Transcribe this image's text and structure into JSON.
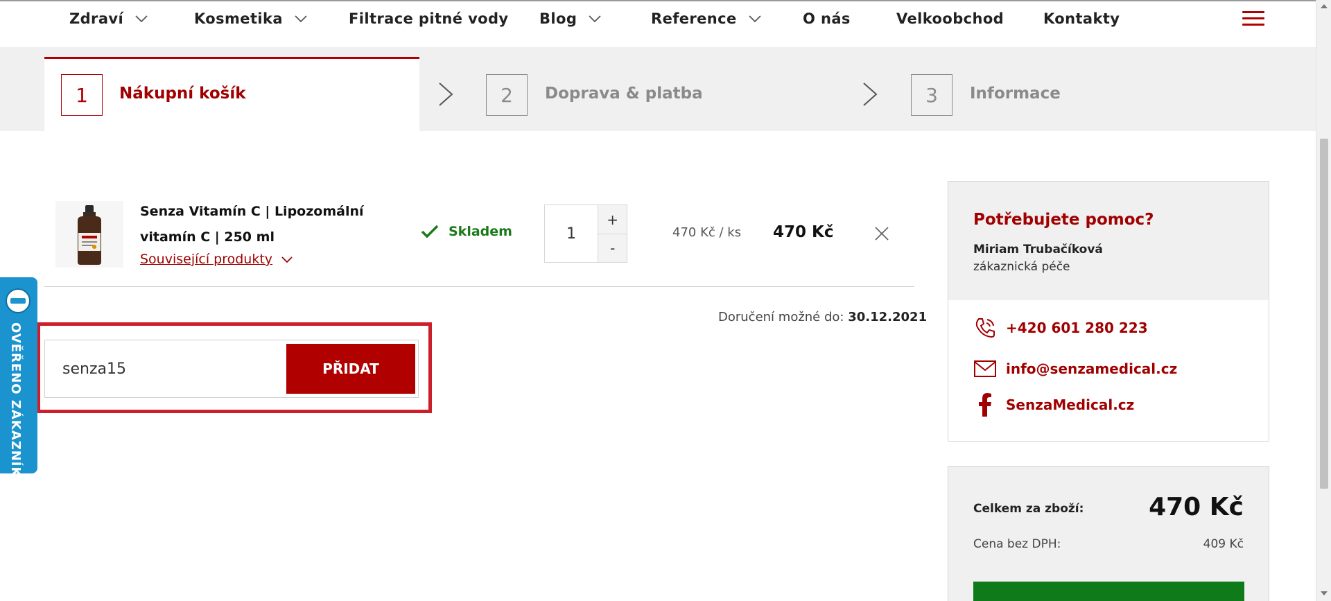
{
  "nav": {
    "items": [
      {
        "label": "Zdraví",
        "has_dropdown": true
      },
      {
        "label": "Kosmetika",
        "has_dropdown": true
      },
      {
        "label": "Filtrace pitné vody",
        "has_dropdown": false
      },
      {
        "label": "Blog",
        "has_dropdown": true
      },
      {
        "label": "Reference",
        "has_dropdown": true
      },
      {
        "label": "O nás",
        "has_dropdown": false
      },
      {
        "label": "Velkoobchod",
        "has_dropdown": false
      },
      {
        "label": "Kontakty",
        "has_dropdown": false
      }
    ],
    "menu_icon": "hamburger-icon"
  },
  "steps": [
    {
      "number": "1",
      "label": "Nákupní košík",
      "active": true
    },
    {
      "number": "2",
      "label": "Doprava & platba",
      "active": false
    },
    {
      "number": "3",
      "label": "Informace",
      "active": false
    }
  ],
  "cart": {
    "item": {
      "title": "Senza Vitamín C | Lipozomální vitamín C | 250 ml",
      "related_label": "Související produkty",
      "stock": "Skladem",
      "quantity": "1",
      "plus": "+",
      "minus": "-",
      "unit_price": "470 Kč / ks",
      "total": "470 Kč"
    },
    "delivery_label": "Doručení možné do:",
    "delivery_date": "30.12.2021"
  },
  "coupon": {
    "value": "senza15",
    "button_label": "PŘIDAT"
  },
  "badge": {
    "text": "OVĚŘENO ZÁKAZNÍKY"
  },
  "help": {
    "title": "Potřebujete pomoc?",
    "name": "Miriam Trubačíková",
    "role": "zákaznická péče",
    "phone": "+420 601 280 223",
    "email": "info@senzamedical.cz",
    "facebook": "SenzaMedical.cz"
  },
  "totals": {
    "label": "Celkem za zboží:",
    "value": "470 Kč",
    "net_label": "Cena bez DPH:",
    "net_value": "409 Kč"
  },
  "colors": {
    "accent": "#b00000",
    "success": "#1b7a1b",
    "badge": "#1a93cf",
    "highlight": "#cc1f2b"
  }
}
